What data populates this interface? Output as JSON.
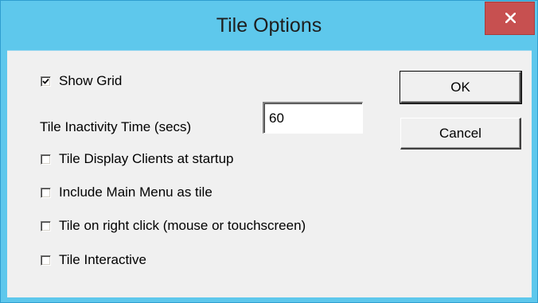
{
  "window": {
    "title": "Tile Options",
    "close_glyph": "x",
    "accent_color": "#5ec8ec",
    "close_color": "#c75050"
  },
  "options": {
    "show_grid": {
      "label": "Show Grid",
      "checked": true
    },
    "inactivity": {
      "label": "Tile Inactivity Time (secs)",
      "value": "60"
    },
    "display_clients": {
      "label": "Tile Display Clients at startup",
      "checked": false
    },
    "main_menu": {
      "label": "Include Main Menu as tile",
      "checked": false
    },
    "right_click": {
      "label": "Tile on right click (mouse or touchscreen)",
      "checked": false
    },
    "interactive": {
      "label": "Tile Interactive",
      "checked": false
    }
  },
  "buttons": {
    "ok": "OK",
    "cancel": "Cancel"
  },
  "icons": {
    "close": "close-icon",
    "check": "checkmark-icon"
  }
}
